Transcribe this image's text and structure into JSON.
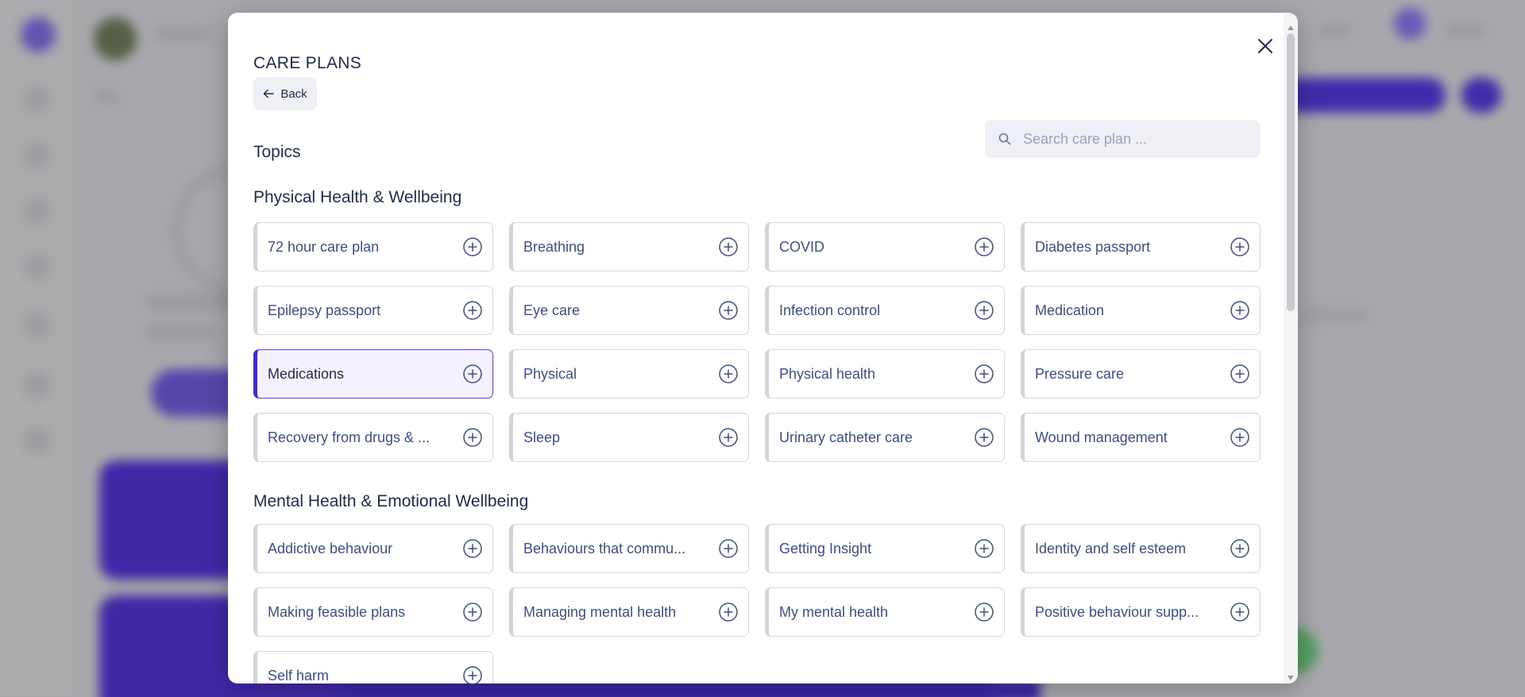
{
  "modal": {
    "title": "CARE PLANS",
    "back_label": "Back",
    "topics_heading": "Topics",
    "search_placeholder": "Search care plan ..."
  },
  "sections": [
    {
      "title": "Physical Health & Wellbeing",
      "items": [
        {
          "label": "72 hour care plan"
        },
        {
          "label": "Breathing"
        },
        {
          "label": "COVID"
        },
        {
          "label": "Diabetes passport"
        },
        {
          "label": "Epilepsy passport"
        },
        {
          "label": "Eye care"
        },
        {
          "label": "Infection control"
        },
        {
          "label": "Medication"
        },
        {
          "label": "Medications",
          "selected": true
        },
        {
          "label": "Physical"
        },
        {
          "label": "Physical health"
        },
        {
          "label": "Pressure care"
        },
        {
          "label": "Recovery from drugs & ..."
        },
        {
          "label": "Sleep"
        },
        {
          "label": "Urinary catheter care"
        },
        {
          "label": "Wound management"
        }
      ]
    },
    {
      "title": "Mental Health & Emotional Wellbeing",
      "items": [
        {
          "label": "Addictive behaviour"
        },
        {
          "label": "Behaviours that commu..."
        },
        {
          "label": "Getting Insight"
        },
        {
          "label": "Identity and self esteem"
        },
        {
          "label": "Making feasible plans"
        },
        {
          "label": "Managing mental health"
        },
        {
          "label": "My mental health"
        },
        {
          "label": "Positive behaviour supp..."
        },
        {
          "label": "Self harm"
        }
      ]
    }
  ],
  "icons": {
    "close": "close-icon",
    "back": "arrow-left-icon",
    "search": "search-icon",
    "add": "plus-circle-icon"
  },
  "colors": {
    "accent": "#4425e8",
    "text": "#1f2b4e",
    "card_text": "#3a4f8a",
    "selected_bg": "#f4f0fd"
  }
}
